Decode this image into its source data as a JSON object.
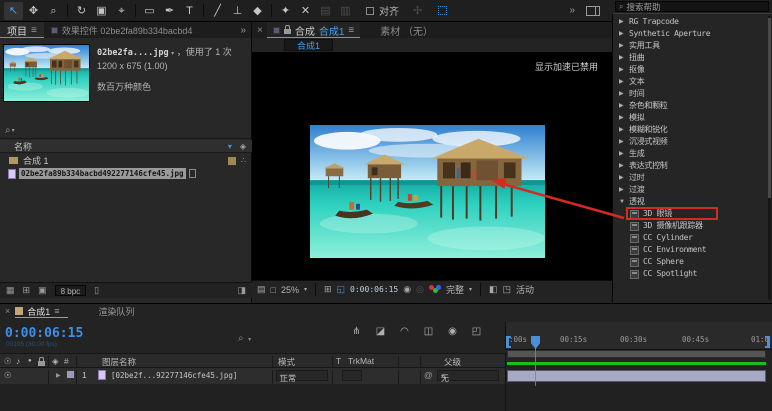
{
  "toolbar": {
    "tools": [
      {
        "name": "selection",
        "glyph": "↖"
      },
      {
        "name": "hand",
        "glyph": "✥"
      },
      {
        "name": "zoom",
        "glyph": "⌕"
      },
      {
        "name": "rotate",
        "glyph": "↻"
      },
      {
        "name": "camera",
        "glyph": "▣"
      },
      {
        "name": "pan-behind",
        "glyph": "⌖"
      },
      {
        "name": "rectangle",
        "glyph": "▭"
      },
      {
        "name": "pen",
        "glyph": "✒"
      },
      {
        "name": "text",
        "glyph": "T"
      },
      {
        "name": "brush",
        "glyph": "╱"
      },
      {
        "name": "clone-stamp",
        "glyph": "⊥"
      },
      {
        "name": "eraser",
        "glyph": "◆"
      },
      {
        "name": "roto-brush",
        "glyph": "✦"
      },
      {
        "name": "puppet-pin",
        "glyph": "✕"
      }
    ],
    "dim_tools": [
      {
        "glyph": "▤"
      },
      {
        "glyph": "▥"
      }
    ],
    "align_label": "对齐",
    "star_glyph": "✢",
    "overflow": "»",
    "search_placeholder": "搜索帮助"
  },
  "icons": {
    "collapsed": "▶",
    "expanded": "▼",
    "menu": "≡",
    "chevron": "▾",
    "close": "×",
    "search": "⌕",
    "overflow": "»",
    "triangle_dots": "∴",
    "eye": "☉",
    "speaker": "♪",
    "solo": "●",
    "tag": "◈",
    "pickwhip": "@"
  },
  "project_panel": {
    "tab_project": "项目",
    "tab_effect_controls": "效果控件 02be2fa89b334bacbd4",
    "preview": {
      "filename": "02be2fa....jpg",
      "usage": "，使用了 1 次",
      "dimensions": "1200 x 675 (1.00)",
      "depth": "数百万种颜色"
    },
    "columns_header": "名称",
    "items": [
      {
        "label": "合成 1"
      },
      {
        "label": "02be2fa89b334bacbd492277146cfe45.jpg"
      }
    ],
    "footer": {
      "bpc": "8 bpc",
      "icon1": "▦",
      "icon2": "⊞",
      "icon3": "▣",
      "trash": "▯",
      "panel": "◨"
    }
  },
  "viewer": {
    "tab_comp_prefix": "合成",
    "tab_comp_name": "合成1",
    "tab_footage": "素材 （无）",
    "breadcrumb": "合成1",
    "overlay_message": "显示加速已禁用",
    "zoom": "25%",
    "timecode": "0:00:06:15",
    "resolution": "完整",
    "camera": "活动",
    "icon_screen": "□",
    "icon_film": "▤",
    "icon_grid": "⊞",
    "icon_roi": "◱",
    "icon_snapshot": "◉",
    "icon_show_snapshot": "◎",
    "icon_target": "◧",
    "icon_pixel_aspect": "◳"
  },
  "effects_panel": {
    "groups": [
      {
        "label": "RG Trapcode"
      },
      {
        "label": "Synthetic Aperture"
      },
      {
        "label": "实用工具"
      },
      {
        "label": "扭曲"
      },
      {
        "label": "抠像"
      },
      {
        "label": "文本"
      },
      {
        "label": "时间"
      },
      {
        "label": "杂色和颗粒"
      },
      {
        "label": "模拟"
      },
      {
        "label": "模糊和锐化"
      },
      {
        "label": "沉浸式视频"
      },
      {
        "label": "生成"
      },
      {
        "label": "表达式控制"
      },
      {
        "label": "过时"
      },
      {
        "label": "过渡"
      },
      {
        "label": "透视"
      }
    ],
    "perspective_effects": [
      {
        "label": "3D 眼镜",
        "highlighted": true
      },
      {
        "label": "3D 摄像机跟踪器"
      },
      {
        "label": "CC Cylinder"
      },
      {
        "label": "CC Environment"
      },
      {
        "label": "CC Sphere"
      },
      {
        "label": "CC Spotlight"
      }
    ]
  },
  "timeline": {
    "tab_comp": "合成1",
    "tab_render_queue": "渲染队列",
    "timecode": "0:00:06:15",
    "frame_info": "00195 (30.00 fps)",
    "toolbar_icons": [
      {
        "name": "mini-flowchart",
        "glyph": "⋔"
      },
      {
        "name": "draft-3d",
        "glyph": "◪"
      },
      {
        "name": "shy",
        "glyph": "◠"
      },
      {
        "name": "frame-blending",
        "glyph": "◫"
      },
      {
        "name": "motion-blur",
        "glyph": "◉"
      },
      {
        "name": "graph-editor",
        "glyph": "◰"
      }
    ],
    "columns": {
      "hash": "#",
      "layer_name": "图层名称",
      "mode": "模式",
      "t": "T",
      "trkmat": "TrkMat",
      "parent": "父级"
    },
    "layer": {
      "index": "1",
      "name": "[02be2f...92277146cfe45.jpg]",
      "mode": "正常",
      "parent": "无"
    },
    "ruler_ticks": [
      ":00s",
      "00:15s",
      "00:30s",
      "00:45s",
      "01:0"
    ]
  },
  "colors": {
    "accent_blue": "#4a90d9",
    "timecode_blue": "#3f8fe8",
    "annotation_red": "#d32a22",
    "render_green": "#16c216",
    "layer_bar": "#a9a9c6",
    "selection_bg": "#9a9a9a"
  }
}
